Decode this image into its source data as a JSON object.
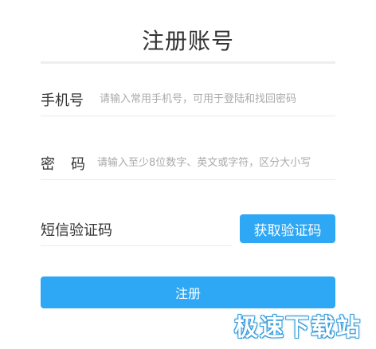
{
  "page": {
    "title": "注册账号"
  },
  "form": {
    "phone": {
      "label": "手机号",
      "placeholder": "请输入常用手机号，可用于登陆和找回密码",
      "value": ""
    },
    "password": {
      "label": "密码",
      "placeholder": "请输入至少8位数字、英文或字符，区分大小写",
      "value": ""
    },
    "sms_code": {
      "label": "短信验证码",
      "placeholder": "",
      "value": "",
      "button_label": "获取验证码"
    },
    "submit_label": "注册"
  },
  "watermark": {
    "text": "极速下载站"
  },
  "colors": {
    "accent": "#2ea7f5",
    "text": "#333333",
    "placeholder": "#aaaaaa",
    "divider": "#eeeeee"
  }
}
